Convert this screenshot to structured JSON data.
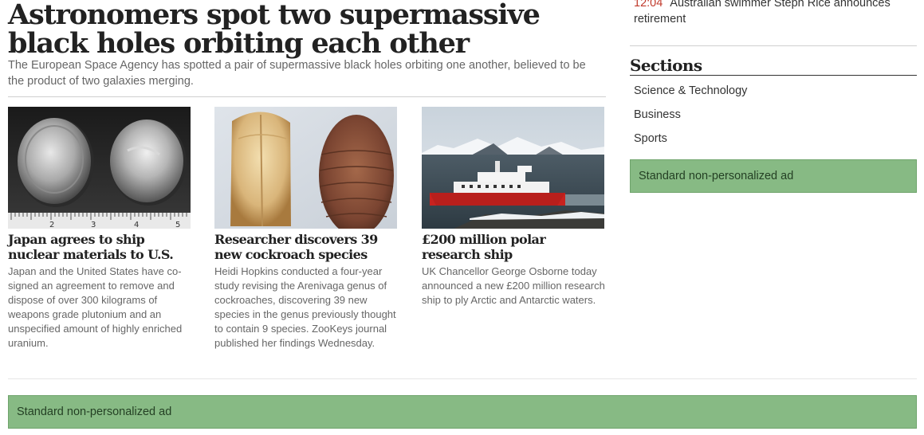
{
  "article": {
    "headline": "Astronomers spot two supermassive black holes orbiting each other",
    "lede": "The European Space Agency has spotted a pair of supermassive black holes orbiting one another, believed to be the product of two galaxies merging."
  },
  "cards": [
    {
      "title": "Japan agrees to ship nuclear materials to U.S.",
      "summary": "Japan and the United States have co-signed an agreement to remove and dispose of over 300 kilograms of weapons grade plutonium and an unspecified amount of highly enriched uranium.",
      "ruler_labels": [
        "2",
        "3",
        "4",
        "5"
      ]
    },
    {
      "title": "Researcher discovers 39 new cockroach species",
      "summary": "Heidi Hopkins conducted a four-year study revising the Arenivaga genus of cockroaches, discovering 39 new species in the genus previously thought to contain 9 species. ZooKeys journal published her findings Wednesday."
    },
    {
      "title": "£200 million polar research ship",
      "summary": "UK Chancellor George Osborne today announced a new £200 million research ship to ply Arctic and Antarctic waters."
    }
  ],
  "sidebar": {
    "breaking": {
      "time": "12:04",
      "text": "Australian swimmer Steph Rice announces retirement"
    },
    "sections_heading": "Sections",
    "sections": [
      "Science & Technology",
      "Business",
      "Sports"
    ],
    "ad_label": "Standard non-personalized ad"
  },
  "bottom_ad": {
    "label": "Standard non-personalized ad"
  },
  "colors": {
    "ad_background": "#87ba84",
    "time_accent": "#c0392b"
  }
}
